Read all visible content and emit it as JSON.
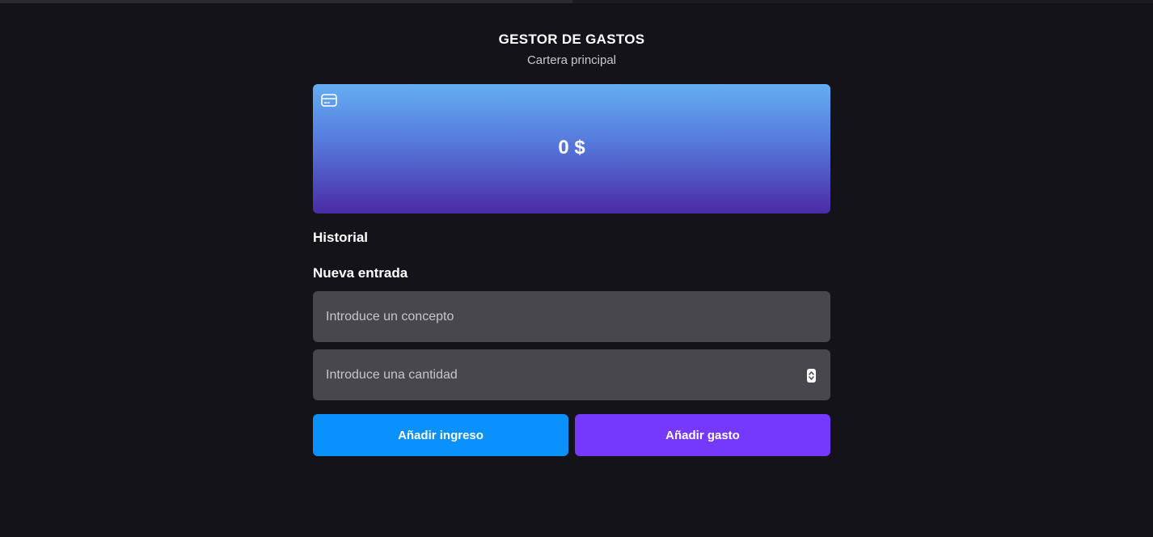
{
  "header": {
    "title": "GESTOR DE GASTOS",
    "subtitle": "Cartera principal"
  },
  "balance_card": {
    "icon": "credit-card-icon",
    "amount": "0 $"
  },
  "history": {
    "title": "Historial"
  },
  "new_entry": {
    "title": "Nueva entrada",
    "concept_placeholder": "Introduce un concepto",
    "amount_placeholder": "Introduce una cantidad",
    "add_income_label": "Añadir ingreso",
    "add_expense_label": "Añadir gasto"
  },
  "colors": {
    "background": "#141319",
    "card_gradient_top": "#64aef2",
    "card_gradient_bottom": "#4a2aa6",
    "field_background": "#48474d",
    "income_button": "#0a91fb",
    "expense_button": "#7439fb"
  }
}
